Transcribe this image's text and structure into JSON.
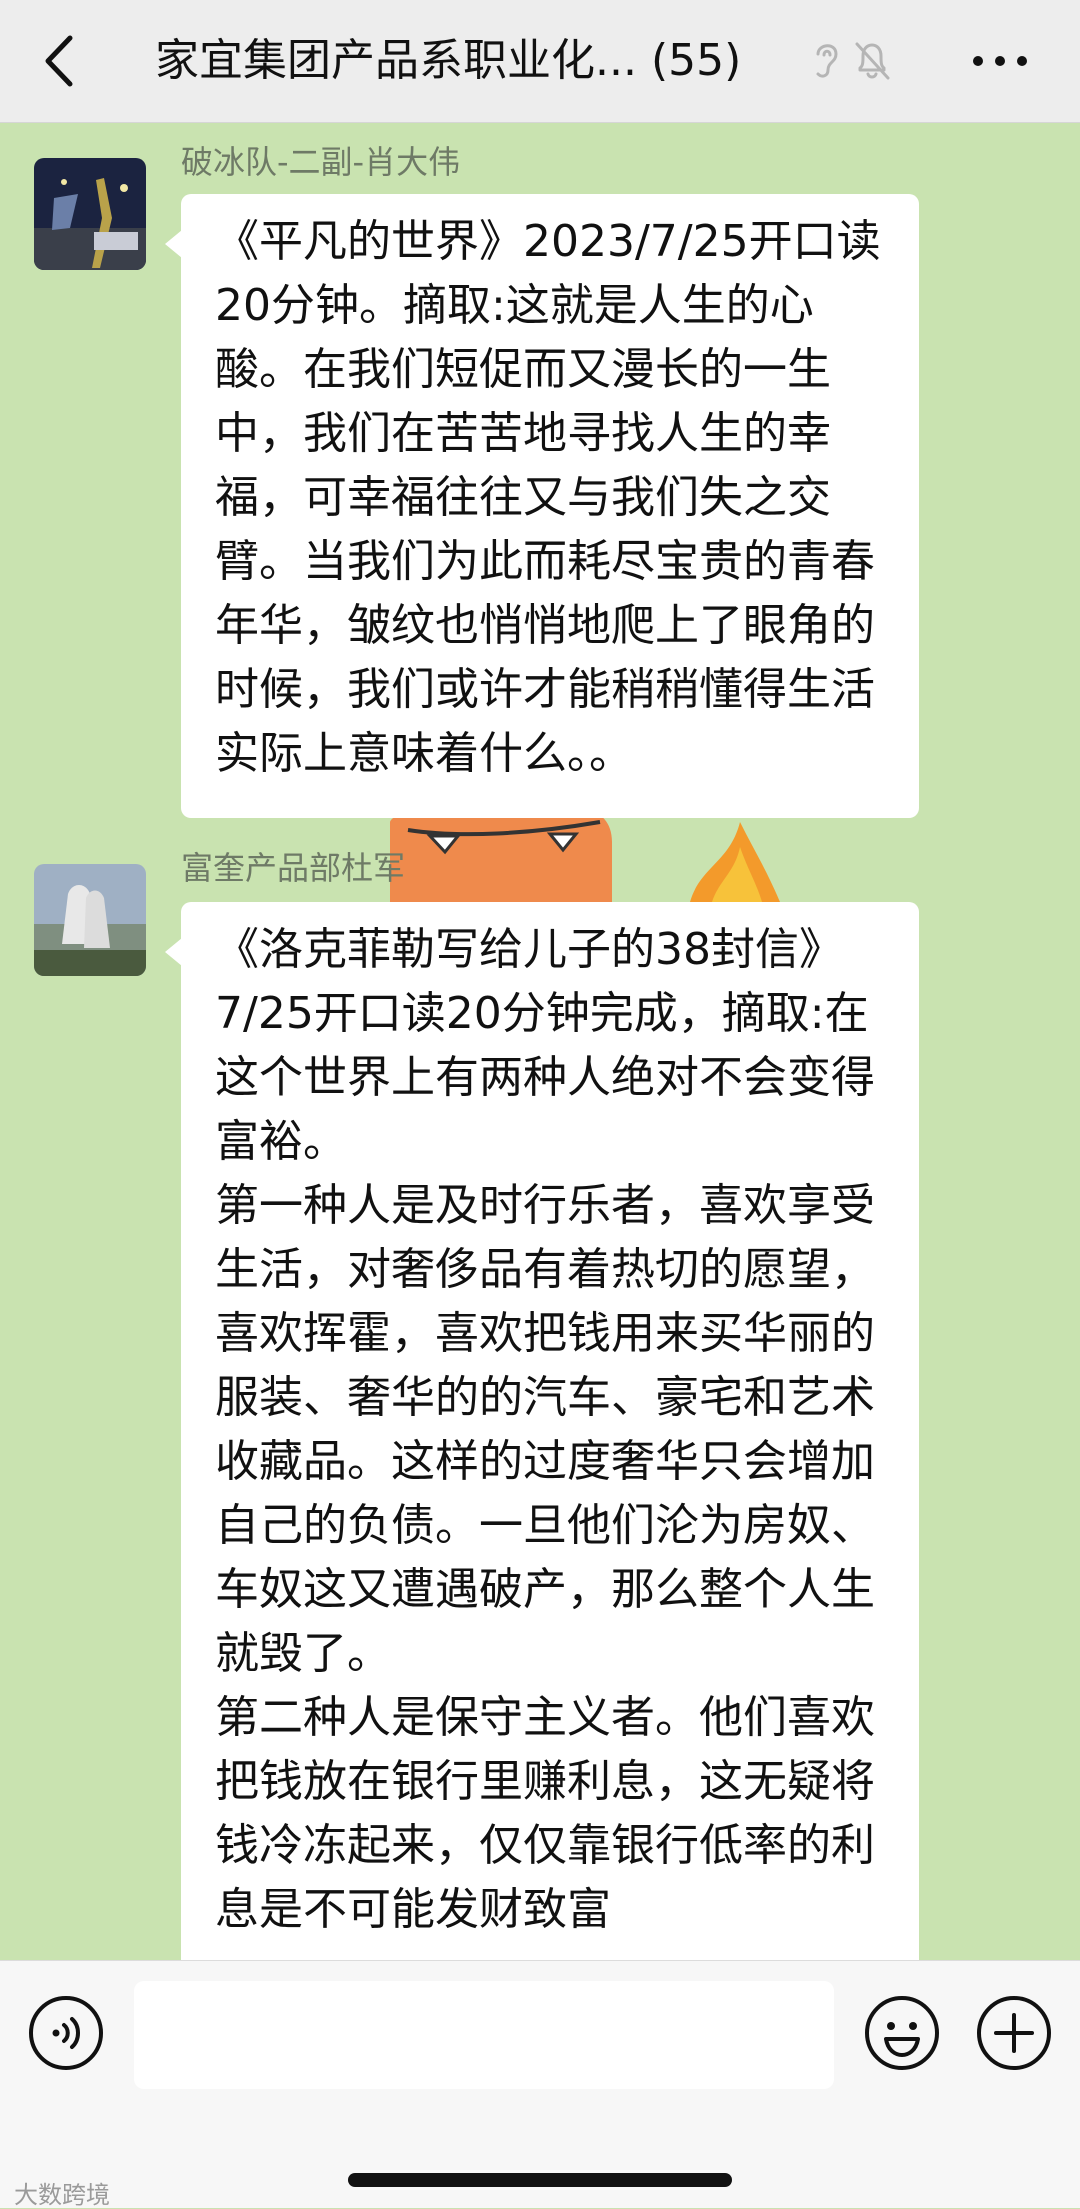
{
  "header": {
    "title": "家宜集团产品系职业化...",
    "member_count": "(55)",
    "back_icon": "chevron-left-icon",
    "ear_icon": "ear-icon",
    "mute_icon": "bell-muted-icon",
    "more_icon": "more-dots-icon"
  },
  "messages": [
    {
      "sender": "破冰队-二副-肖大伟",
      "text": "《平凡的世界》2023/7/25开口读20分钟。摘取:这就是人生的心酸。在我们短促而又漫长的一生中，我们在苦苦地寻找人生的幸福，可幸福往往又与我们失之交臂。当我们为此而耗尽宝贵的青春年华，皱纹也悄悄地爬上了眼角的时候，我们或许才能稍稍懂得生活实际上意味着什么。。"
    },
    {
      "sender": "富奎产品部杜军",
      "text": "《洛克菲勒写给儿子的38封信》\n7/25开口读20分钟完成，摘取:在这个世界上有两种人绝对不会变得富裕。\n第一种人是及时行乐者，喜欢享受生活，对奢侈品有着热切的愿望，喜欢挥霍，喜欢把钱用来买华丽的服装、奢华的的汽车、豪宅和艺术收藏品。这样的过度奢华只会增加自己的负债。一旦他们沦为房奴、车奴这又遭遇破产，那么整个人生就毁了。\n第二种人是保守主义者。他们喜欢把钱放在银行里赚利息，这无疑将钱冷冻起来，仅仅靠银行低率的利息是不可能发财致富"
    }
  ],
  "toolbar": {
    "voice_icon": "voice-icon",
    "input_value": "",
    "emoji_icon": "emoji-icon",
    "plus_icon": "plus-icon"
  },
  "watermark": "大数跨境",
  "colors": {
    "chat_background": "#c9e3b0",
    "bubble": "#ffffff",
    "header": "#ededed"
  }
}
